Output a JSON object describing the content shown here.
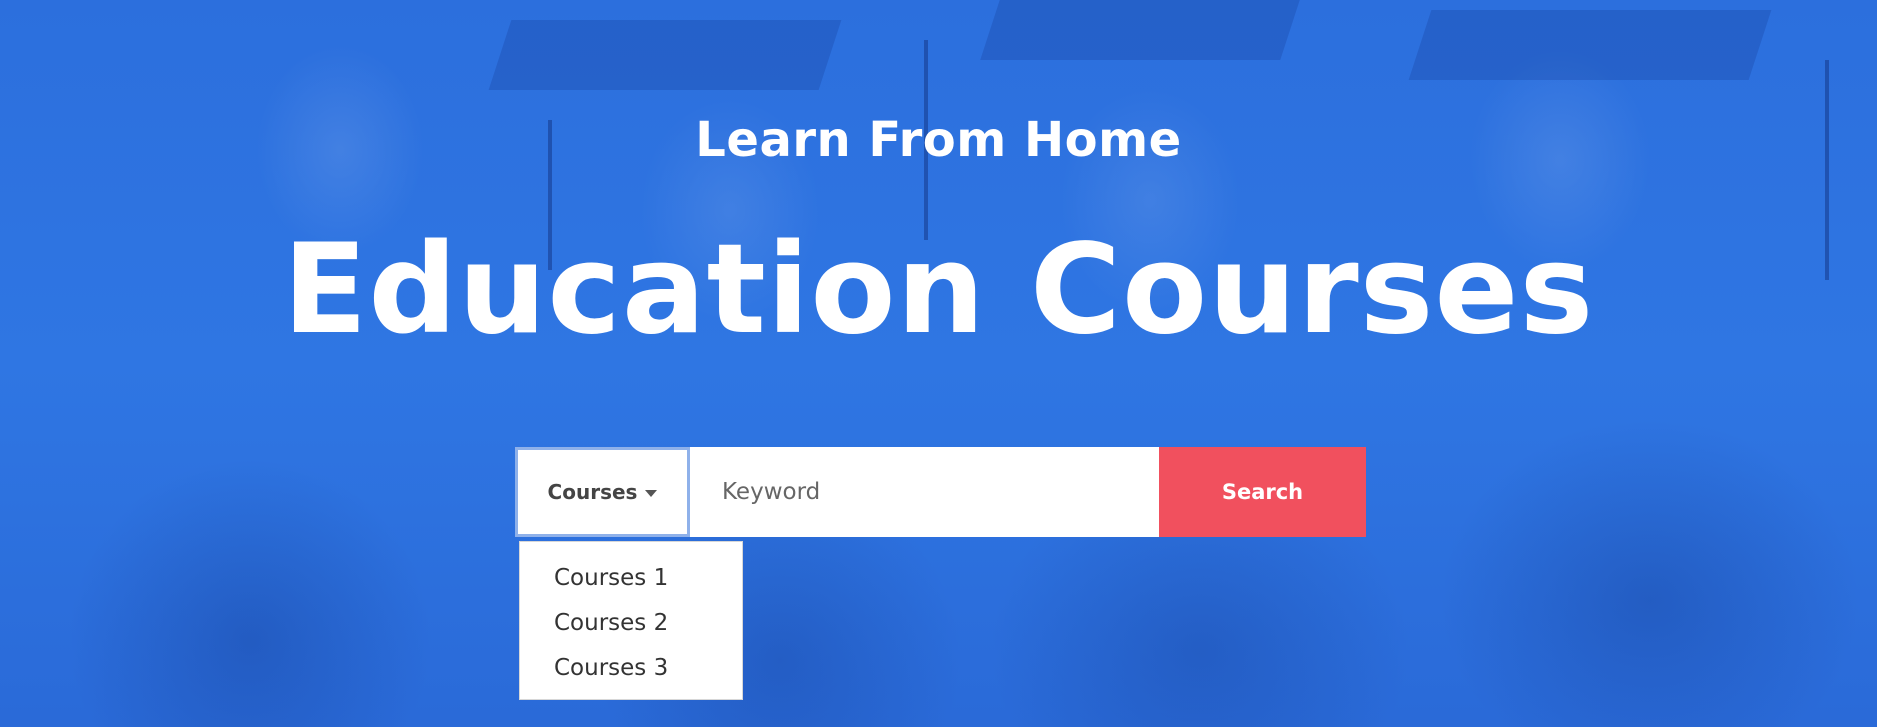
{
  "hero": {
    "subtitle": "Learn From Home",
    "title": "Education Courses"
  },
  "search": {
    "category_label": "Courses",
    "keyword_placeholder": "Keyword",
    "keyword_value": "",
    "button_label": "Search"
  },
  "dropdown": {
    "items": [
      {
        "label": "Courses 1"
      },
      {
        "label": "Courses 2"
      },
      {
        "label": "Courses 3"
      }
    ]
  },
  "colors": {
    "hero_overlay": "#2f74e0",
    "search_button": "#f1505e",
    "text_light": "#ffffff"
  },
  "icons": {
    "category_caret": "caret-down-icon"
  }
}
